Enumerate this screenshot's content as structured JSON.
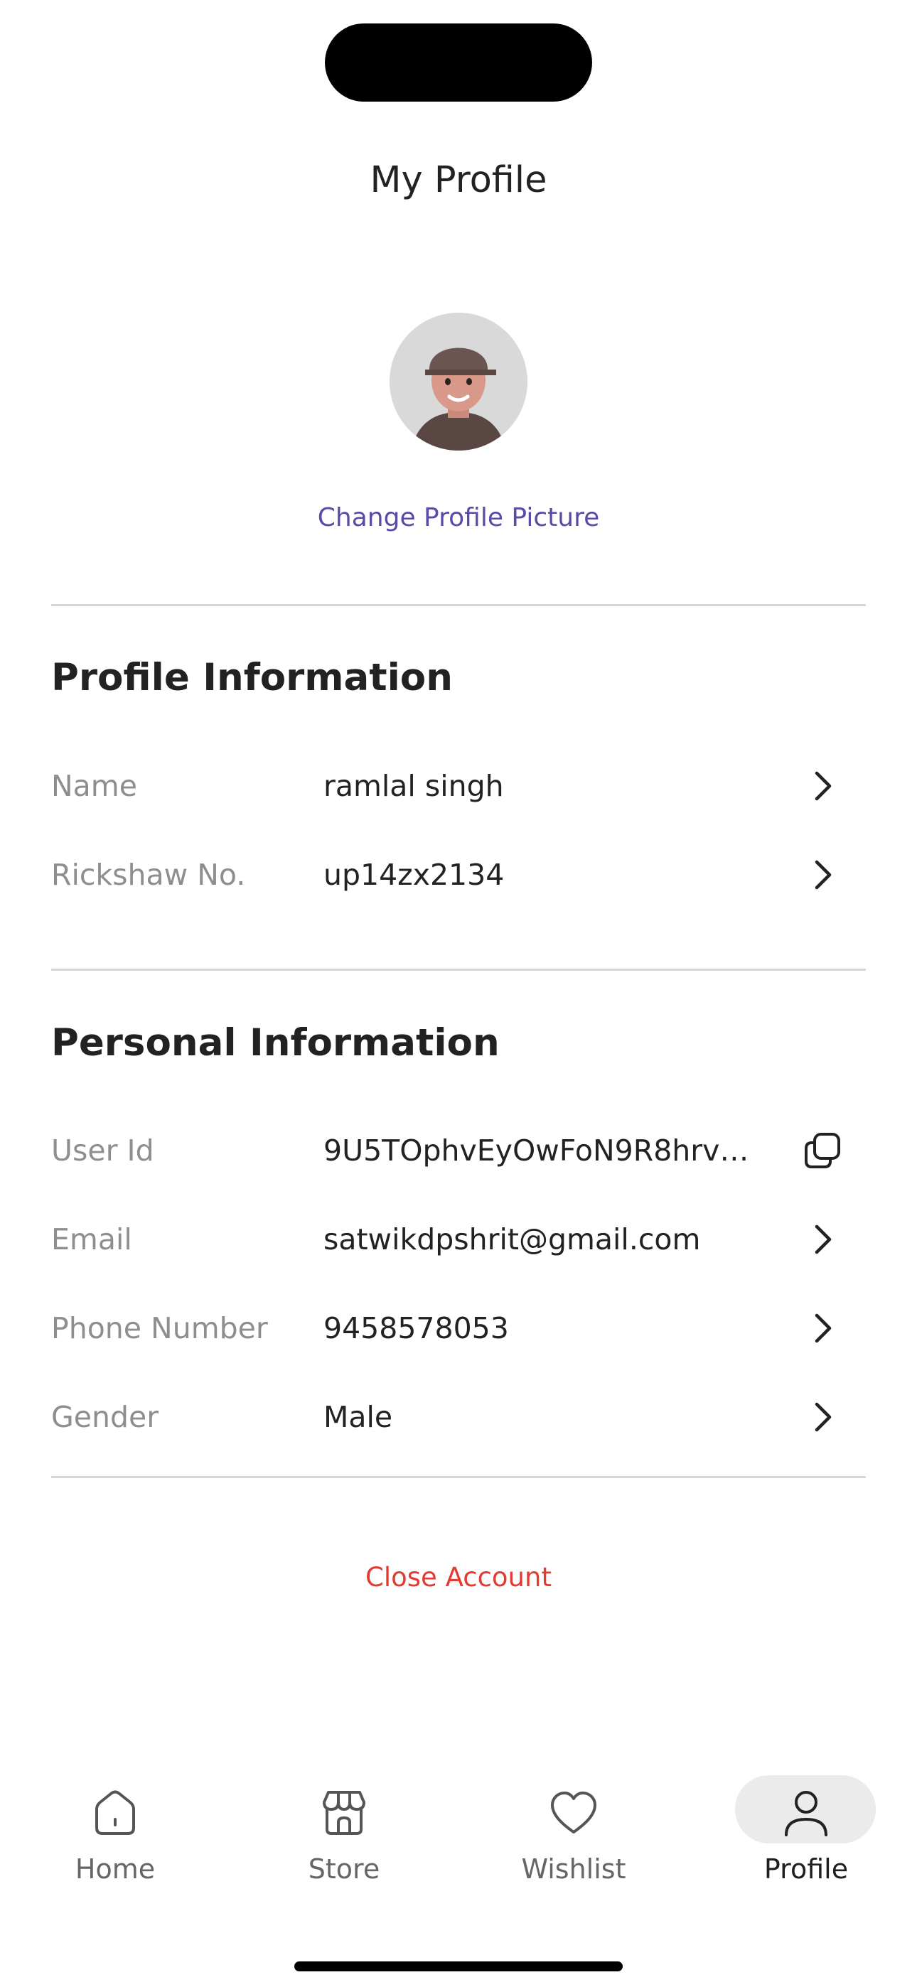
{
  "header": {
    "title": "My Profile"
  },
  "avatar": {
    "icon": "user-avatar-3d"
  },
  "change_picture_label": "Change Profile Picture",
  "profile_section": {
    "title": "Profile Information",
    "rows": [
      {
        "label": "Name",
        "value": "ramlal singh",
        "action": "chevron-right-icon"
      },
      {
        "label": "Rickshaw No.",
        "value": "up14zx2134",
        "action": "chevron-right-icon"
      }
    ]
  },
  "personal_section": {
    "title": "Personal Information",
    "rows": [
      {
        "label": "User Id",
        "value": "9U5TOphvEyOwFoN9R8hrvU...",
        "action": "copy-icon"
      },
      {
        "label": "Email",
        "value": "satwikdpshrit@gmail.com",
        "action": "chevron-right-icon"
      },
      {
        "label": "Phone Number",
        "value": "9458578053",
        "action": "chevron-right-icon"
      },
      {
        "label": "Gender",
        "value": "Male",
        "action": "chevron-right-icon"
      }
    ]
  },
  "close_account_label": "Close Account",
  "tabbar": {
    "tabs": [
      {
        "label": "Home",
        "icon": "home-icon",
        "active": false
      },
      {
        "label": "Store",
        "icon": "store-icon",
        "active": false
      },
      {
        "label": "Wishlist",
        "icon": "heart-icon",
        "active": false
      },
      {
        "label": "Profile",
        "icon": "user-icon",
        "active": true
      }
    ]
  },
  "colors": {
    "accent": "#5b4aa8",
    "danger": "#e53a2f",
    "label": "#8e8e8e",
    "active_tab_bg": "#ebebeb"
  }
}
